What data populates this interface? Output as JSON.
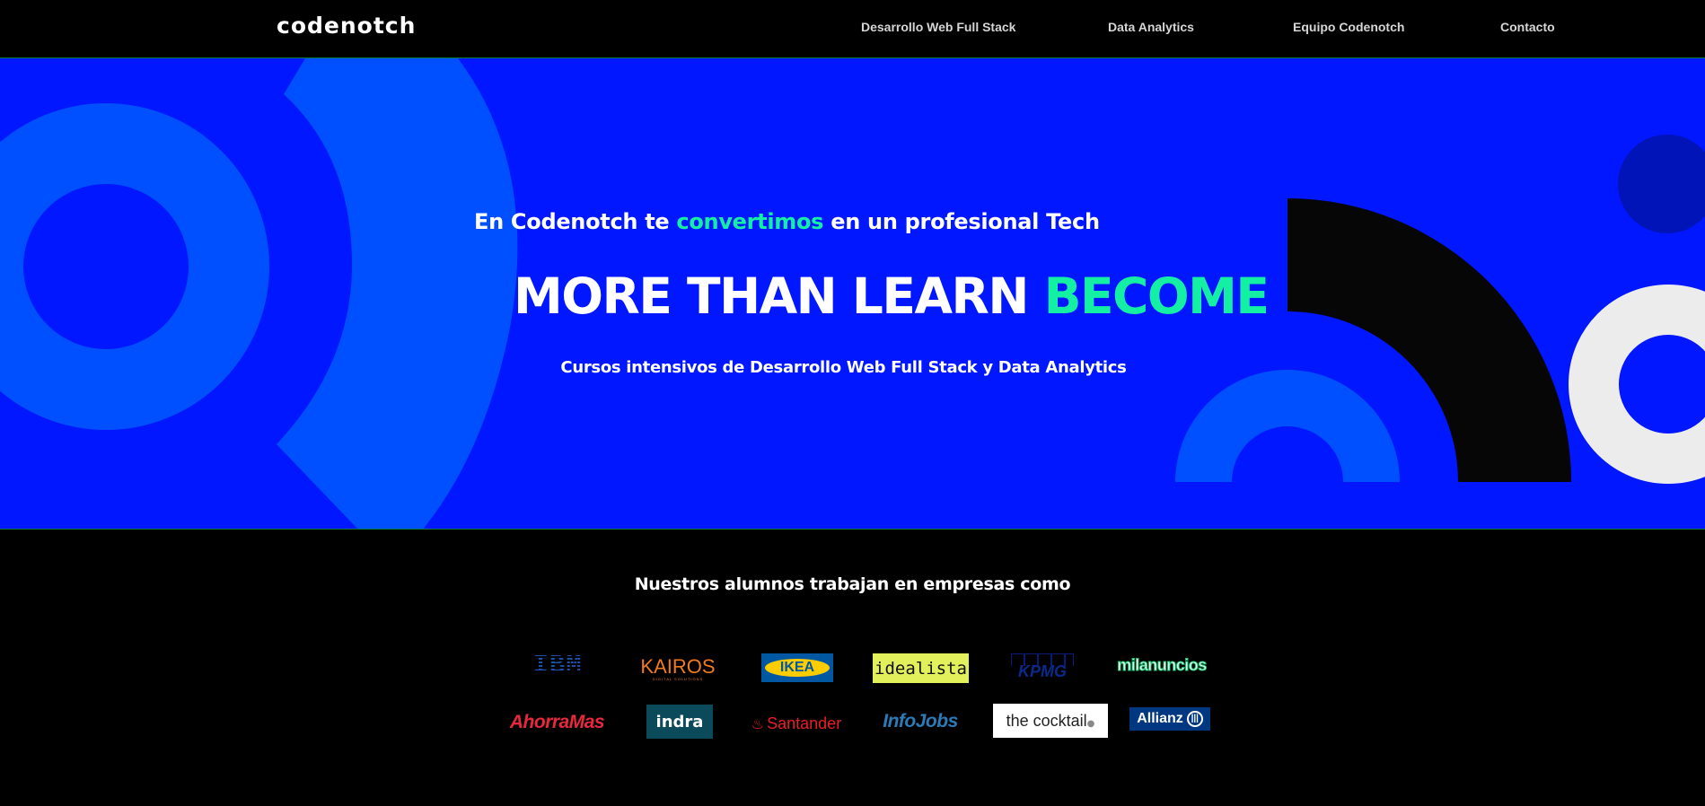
{
  "header": {
    "logo_text": "codenotch",
    "nav": [
      {
        "label": "Desarrollo Web Full Stack"
      },
      {
        "label": "Data Analytics"
      },
      {
        "label": "Equipo Codenotch"
      },
      {
        "label": "Contacto"
      }
    ]
  },
  "hero": {
    "tagline_before": "En Codenotch te ",
    "tagline_accent": "convertimos",
    "tagline_after": " en un profesional Tech",
    "headline_main": "MORE THAN LEARN ",
    "headline_accent": "BECOME",
    "subline": "Cursos intensivos de Desarrollo Web Full Stack y Data Analytics"
  },
  "companies": {
    "title": "Nuestros alumnos trabajan en empresas como",
    "logos": [
      {
        "name": "IBM"
      },
      {
        "name": "KAIROS",
        "tagline": "DIGITAL SOLUTIONS"
      },
      {
        "name": "IKEA"
      },
      {
        "name": "idealista"
      },
      {
        "name": "KPMG"
      },
      {
        "name": "milanuncios"
      },
      {
        "name": "AhorraMas"
      },
      {
        "name": "indra"
      },
      {
        "name": "Santander"
      },
      {
        "name": "InfoJobs"
      },
      {
        "name": "the cocktail"
      },
      {
        "name": "Allianz"
      }
    ]
  },
  "colors": {
    "hero_bg": "#0017ff",
    "accent": "#14f0a3",
    "header_bg": "#000000"
  }
}
